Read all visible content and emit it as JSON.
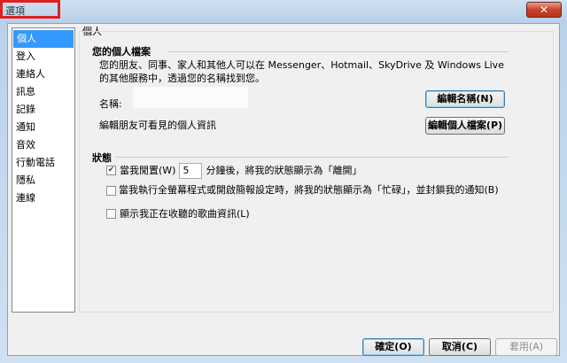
{
  "window": {
    "title": "選項",
    "close_glyph": "✕"
  },
  "nav": {
    "items": [
      {
        "label": "個人"
      },
      {
        "label": "登入"
      },
      {
        "label": "連絡人"
      },
      {
        "label": "訊息"
      },
      {
        "label": "記錄"
      },
      {
        "label": "通知"
      },
      {
        "label": "音效"
      },
      {
        "label": "行動電話"
      },
      {
        "label": "隱私"
      },
      {
        "label": "連線"
      }
    ],
    "selected_index": 0
  },
  "panel": {
    "label": "個人",
    "profile": {
      "title": "您的個人檔案",
      "description": "您的朋友、同事、家人和其他人可以在 Messenger、Hotmail、SkyDrive 及 Windows Live 的其他服務中，透過您的名稱找到您。",
      "name_label": "名稱:",
      "name_value": "",
      "edit_name_button": "編輯名稱(N)",
      "edit_info_label": "編輯朋友可看見的個人資訊",
      "edit_profile_button": "編輯個人檔案(P)"
    },
    "status": {
      "title": "狀態",
      "away_checked": true,
      "away_label_before": "當我閒置(W)",
      "away_minutes": "5",
      "away_label_after": "分鐘後，將我的狀態顯示為「離開」",
      "busy_checked": false,
      "busy_label": "當我執行全螢幕程式或開啟簡報設定時，將我的狀態顯示為「忙碌」，並封鎖我的通知(B)",
      "music_checked": false,
      "music_label": "顯示我正在收聽的歌曲資訊(L)"
    }
  },
  "footer": {
    "ok_button": "確定(O)",
    "cancel_button": "取消(C)",
    "apply_button": "套用(A)",
    "apply_enabled": false
  }
}
